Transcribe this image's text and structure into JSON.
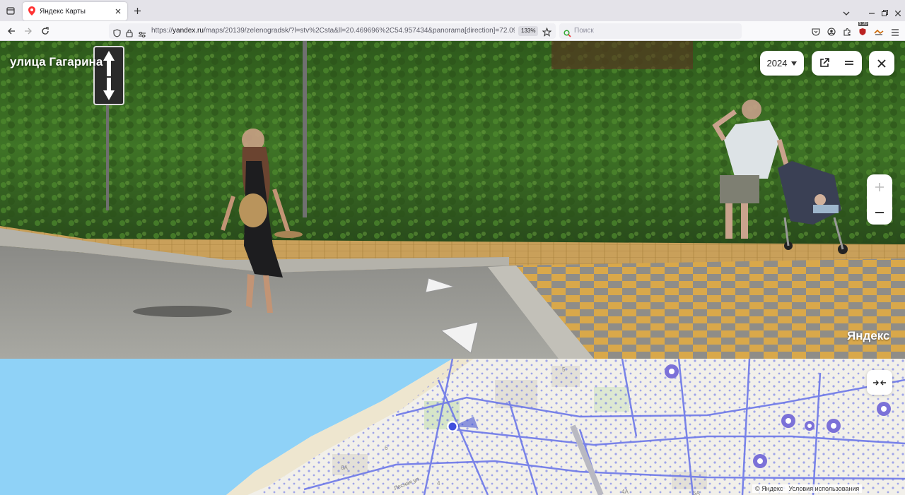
{
  "browser": {
    "tab": {
      "title": "Яндекс Карты"
    },
    "url": {
      "prefix": "https://",
      "domain": "yandex.ru",
      "path": "/maps/20139/zelenogradsk/?l=stv%2Csta&ll=20.469696%2C54.957434&panorama[direction]=72.095996"
    },
    "zoom": "133%",
    "search_placeholder": "Поиск",
    "extension_badge": "9.99"
  },
  "panorama": {
    "street_name": "улица Гагарина",
    "year": "2024",
    "watermark": "Яндекс"
  },
  "map": {
    "copyright": "© Яндекс",
    "terms": "Условия использования",
    "labels": [
      "5",
      "6",
      "6А",
      "4",
      "4А",
      "5А",
      "Лесная ул."
    ]
  },
  "colors": {
    "accent": "#4e5ee0",
    "water": "#8fd2f7"
  },
  "icons": [
    "tab-list-icon",
    "yandex-maps-favicon",
    "close-icon",
    "plus-icon",
    "back-icon",
    "forward-icon",
    "reload-icon",
    "shield-icon",
    "lock-icon",
    "permissions-icon",
    "star-icon",
    "pocket-icon",
    "account-icon",
    "extensions-icon",
    "menu-icon"
  ]
}
